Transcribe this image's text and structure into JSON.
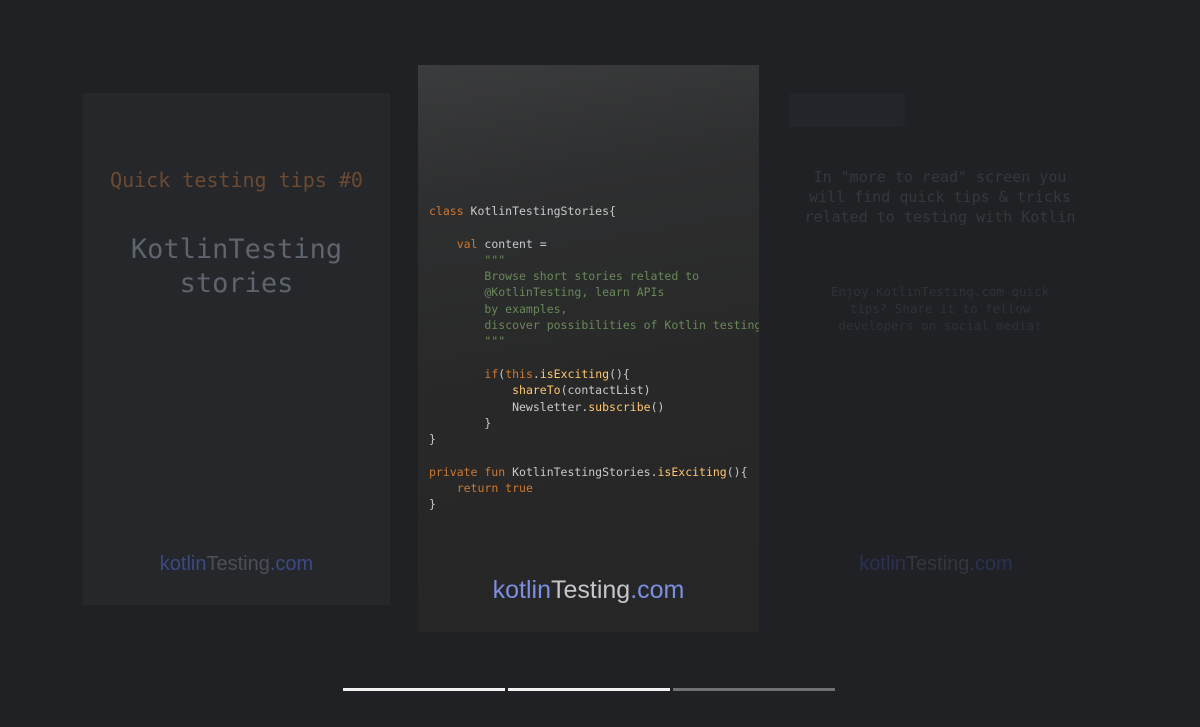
{
  "stories": {
    "previous": {
      "tips_title": "Quick testing tips #0",
      "title_line1": "KotlinTesting",
      "title_line2": "stories",
      "brand": {
        "part1": "kotlin",
        "part2": "Testing",
        "part3": ".com"
      }
    },
    "current": {
      "code_lines": [
        [
          {
            "t": "class ",
            "c": "kw"
          },
          {
            "t": "KotlinTestingStories{",
            "c": "plain"
          }
        ],
        [],
        [
          {
            "t": "    ",
            "c": "plain"
          },
          {
            "t": "val ",
            "c": "kw"
          },
          {
            "t": "content =",
            "c": "plain"
          }
        ],
        [
          {
            "t": "        \"\"\"",
            "c": "str"
          }
        ],
        [
          {
            "t": "        Browse short stories related to",
            "c": "str"
          }
        ],
        [
          {
            "t": "        @KotlinTesting, learn APIs",
            "c": "str"
          }
        ],
        [
          {
            "t": "        by examples,",
            "c": "str"
          }
        ],
        [
          {
            "t": "        discover possibilities of Kotlin testing",
            "c": "str"
          }
        ],
        [
          {
            "t": "        \"\"\"",
            "c": "str"
          }
        ],
        [],
        [
          {
            "t": "        ",
            "c": "plain"
          },
          {
            "t": "if",
            "c": "kw"
          },
          {
            "t": "(",
            "c": "plain"
          },
          {
            "t": "this",
            "c": "kw"
          },
          {
            "t": ".",
            "c": "plain"
          },
          {
            "t": "isExciting",
            "c": "fn"
          },
          {
            "t": "(){",
            "c": "plain"
          }
        ],
        [
          {
            "t": "            ",
            "c": "plain"
          },
          {
            "t": "shareTo",
            "c": "fn"
          },
          {
            "t": "(contactList)",
            "c": "plain"
          }
        ],
        [
          {
            "t": "            Newsletter.",
            "c": "plain"
          },
          {
            "t": "subscribe",
            "c": "fn"
          },
          {
            "t": "()",
            "c": "plain"
          }
        ],
        [
          {
            "t": "        }",
            "c": "plain"
          }
        ],
        [
          {
            "t": "}",
            "c": "plain"
          }
        ],
        [],
        [
          {
            "t": "private fun ",
            "c": "kw"
          },
          {
            "t": "KotlinTestingStories.",
            "c": "plain"
          },
          {
            "t": "isExciting",
            "c": "fn"
          },
          {
            "t": "(){",
            "c": "plain"
          }
        ],
        [
          {
            "t": "    ",
            "c": "plain"
          },
          {
            "t": "return true",
            "c": "kw"
          }
        ],
        [
          {
            "t": "}",
            "c": "plain"
          }
        ]
      ],
      "brand": {
        "part1": "kotlin",
        "part2": "Testing",
        "part3": ".com"
      }
    },
    "next": {
      "main_text": "In \"more to read\" screen you will find quick tips & tricks related to testing with Kotlin",
      "sub_text": "Enjoy KotlinTesting.com quick tips? Share it to fellow developers on social media!",
      "brand": {
        "part1": "kotlin",
        "part2": "Testing",
        "part3": ".com"
      }
    }
  },
  "progress": [
    1,
    1,
    0
  ]
}
